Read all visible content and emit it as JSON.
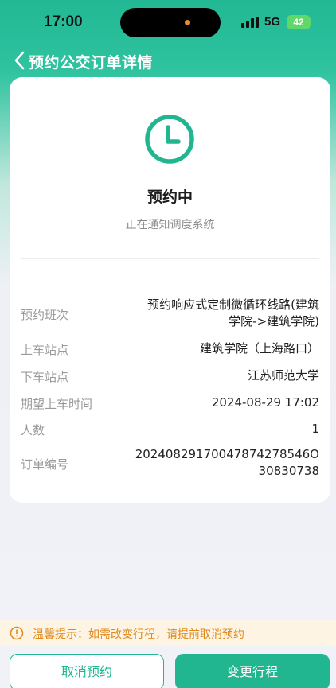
{
  "status_bar": {
    "time": "17:00",
    "network": "5G",
    "battery": "42"
  },
  "header": {
    "title": "预约公交订单详情"
  },
  "order_status": {
    "title": "预约中",
    "subtitle": "正在通知调度系统"
  },
  "details": {
    "route": {
      "label": "预约班次",
      "value_line1": "预约响应式定制微循环线路(建筑",
      "value_line2": "学院->建筑学院)"
    },
    "board": {
      "label": "上车站点",
      "value": "建筑学院（上海路口）"
    },
    "alight": {
      "label": "下车站点",
      "value": "江苏师范大学"
    },
    "time": {
      "label": "期望上车时间",
      "value": "2024-08-29 17:02"
    },
    "people": {
      "label": "人数",
      "value": "1"
    },
    "order": {
      "label": "订单编号",
      "value_line1": "20240829170047874278546O",
      "value_line2": "30830738"
    }
  },
  "tip": {
    "text": "温馨提示：如需改变行程，请提前取消预约"
  },
  "actions": {
    "cancel_label": "取消预约",
    "change_label": "变更行程"
  },
  "colors": {
    "accent": "#21b68f",
    "warning": "#e08a1e",
    "warning_bg": "#fdf4e4"
  }
}
